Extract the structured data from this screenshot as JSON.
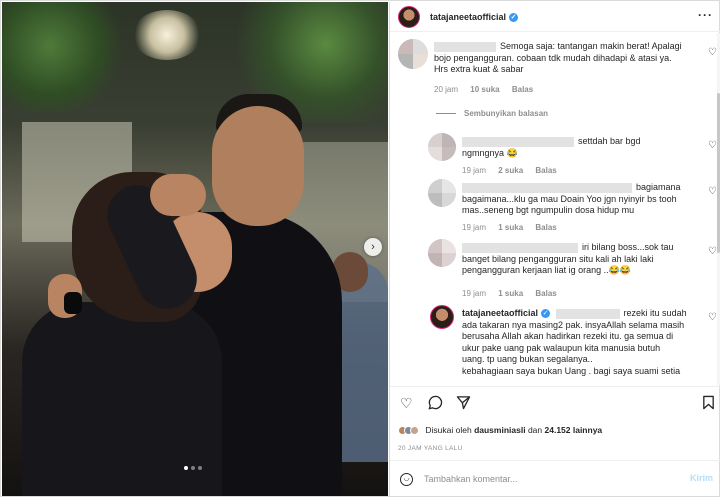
{
  "post": {
    "username": "tatajaneetaofficial",
    "more_icon": "ellipsis-icon"
  },
  "comments": [
    {
      "text_lines": [
        "Semoga saja: tantangan makin berat! Apalagi",
        "bojo pengangguran. cobaan tdk mudah dihadapi & atasi ya.",
        "Hrs extra kuat & sabar"
      ],
      "time": "20 jam",
      "likes": "10 suka",
      "reply": "Balas"
    }
  ],
  "hide_replies": "Sembunyikan balasan",
  "replies": [
    {
      "text_lines": [
        "settdah bar bgd",
        "ngmngnya 😂"
      ],
      "time": "19 jam",
      "likes": "2 suka",
      "reply": "Balas"
    },
    {
      "text_lines": [
        "bagiamana",
        "bagaimana...klu ga mau Doain Yoo jgn nyinyir bs tooh",
        "mas..seneng bgt ngumpulin dosa hidup mu"
      ],
      "time": "19 jam",
      "likes": "1 suka",
      "reply": "Balas"
    },
    {
      "text_lines": [
        "iri bilang boss...sok tau",
        "banget bilang pengangguran situ kali ah laki laki",
        "pengangguran kerjaan liat ig orang ..😂😂"
      ],
      "time": "19 jam",
      "likes": "1 suka",
      "reply": "Balas"
    },
    {
      "author": "tatajaneetaofficial",
      "text_lines": [
        "rezeki itu sudah",
        "ada takaran nya masing2 pak. insyaAllah selama masih",
        "berusaha Allah akan hadirkan rezeki itu. ga semua di",
        "ukur pake uang pak walaupun kita manusia butuh",
        "uang. tp uang bukan segalanya..",
        "kebahagiaan saya bukan Uang . bagi saya suami setia"
      ]
    }
  ],
  "actions": {
    "liked_by_prefix": "Disukai oleh",
    "liked_by_user": "dausminiasli",
    "liked_by_connector": "dan",
    "liked_by_count": "24.152 lainnya",
    "timestamp": "20 JAM YANG LALU"
  },
  "comment_box": {
    "placeholder": "Tambahkan komentar...",
    "post_label": "Kirim"
  },
  "colors": {
    "verified": "#3897f0",
    "secondary_text": "#8e8e8e",
    "post_button_disabled": "#b2dffc"
  }
}
